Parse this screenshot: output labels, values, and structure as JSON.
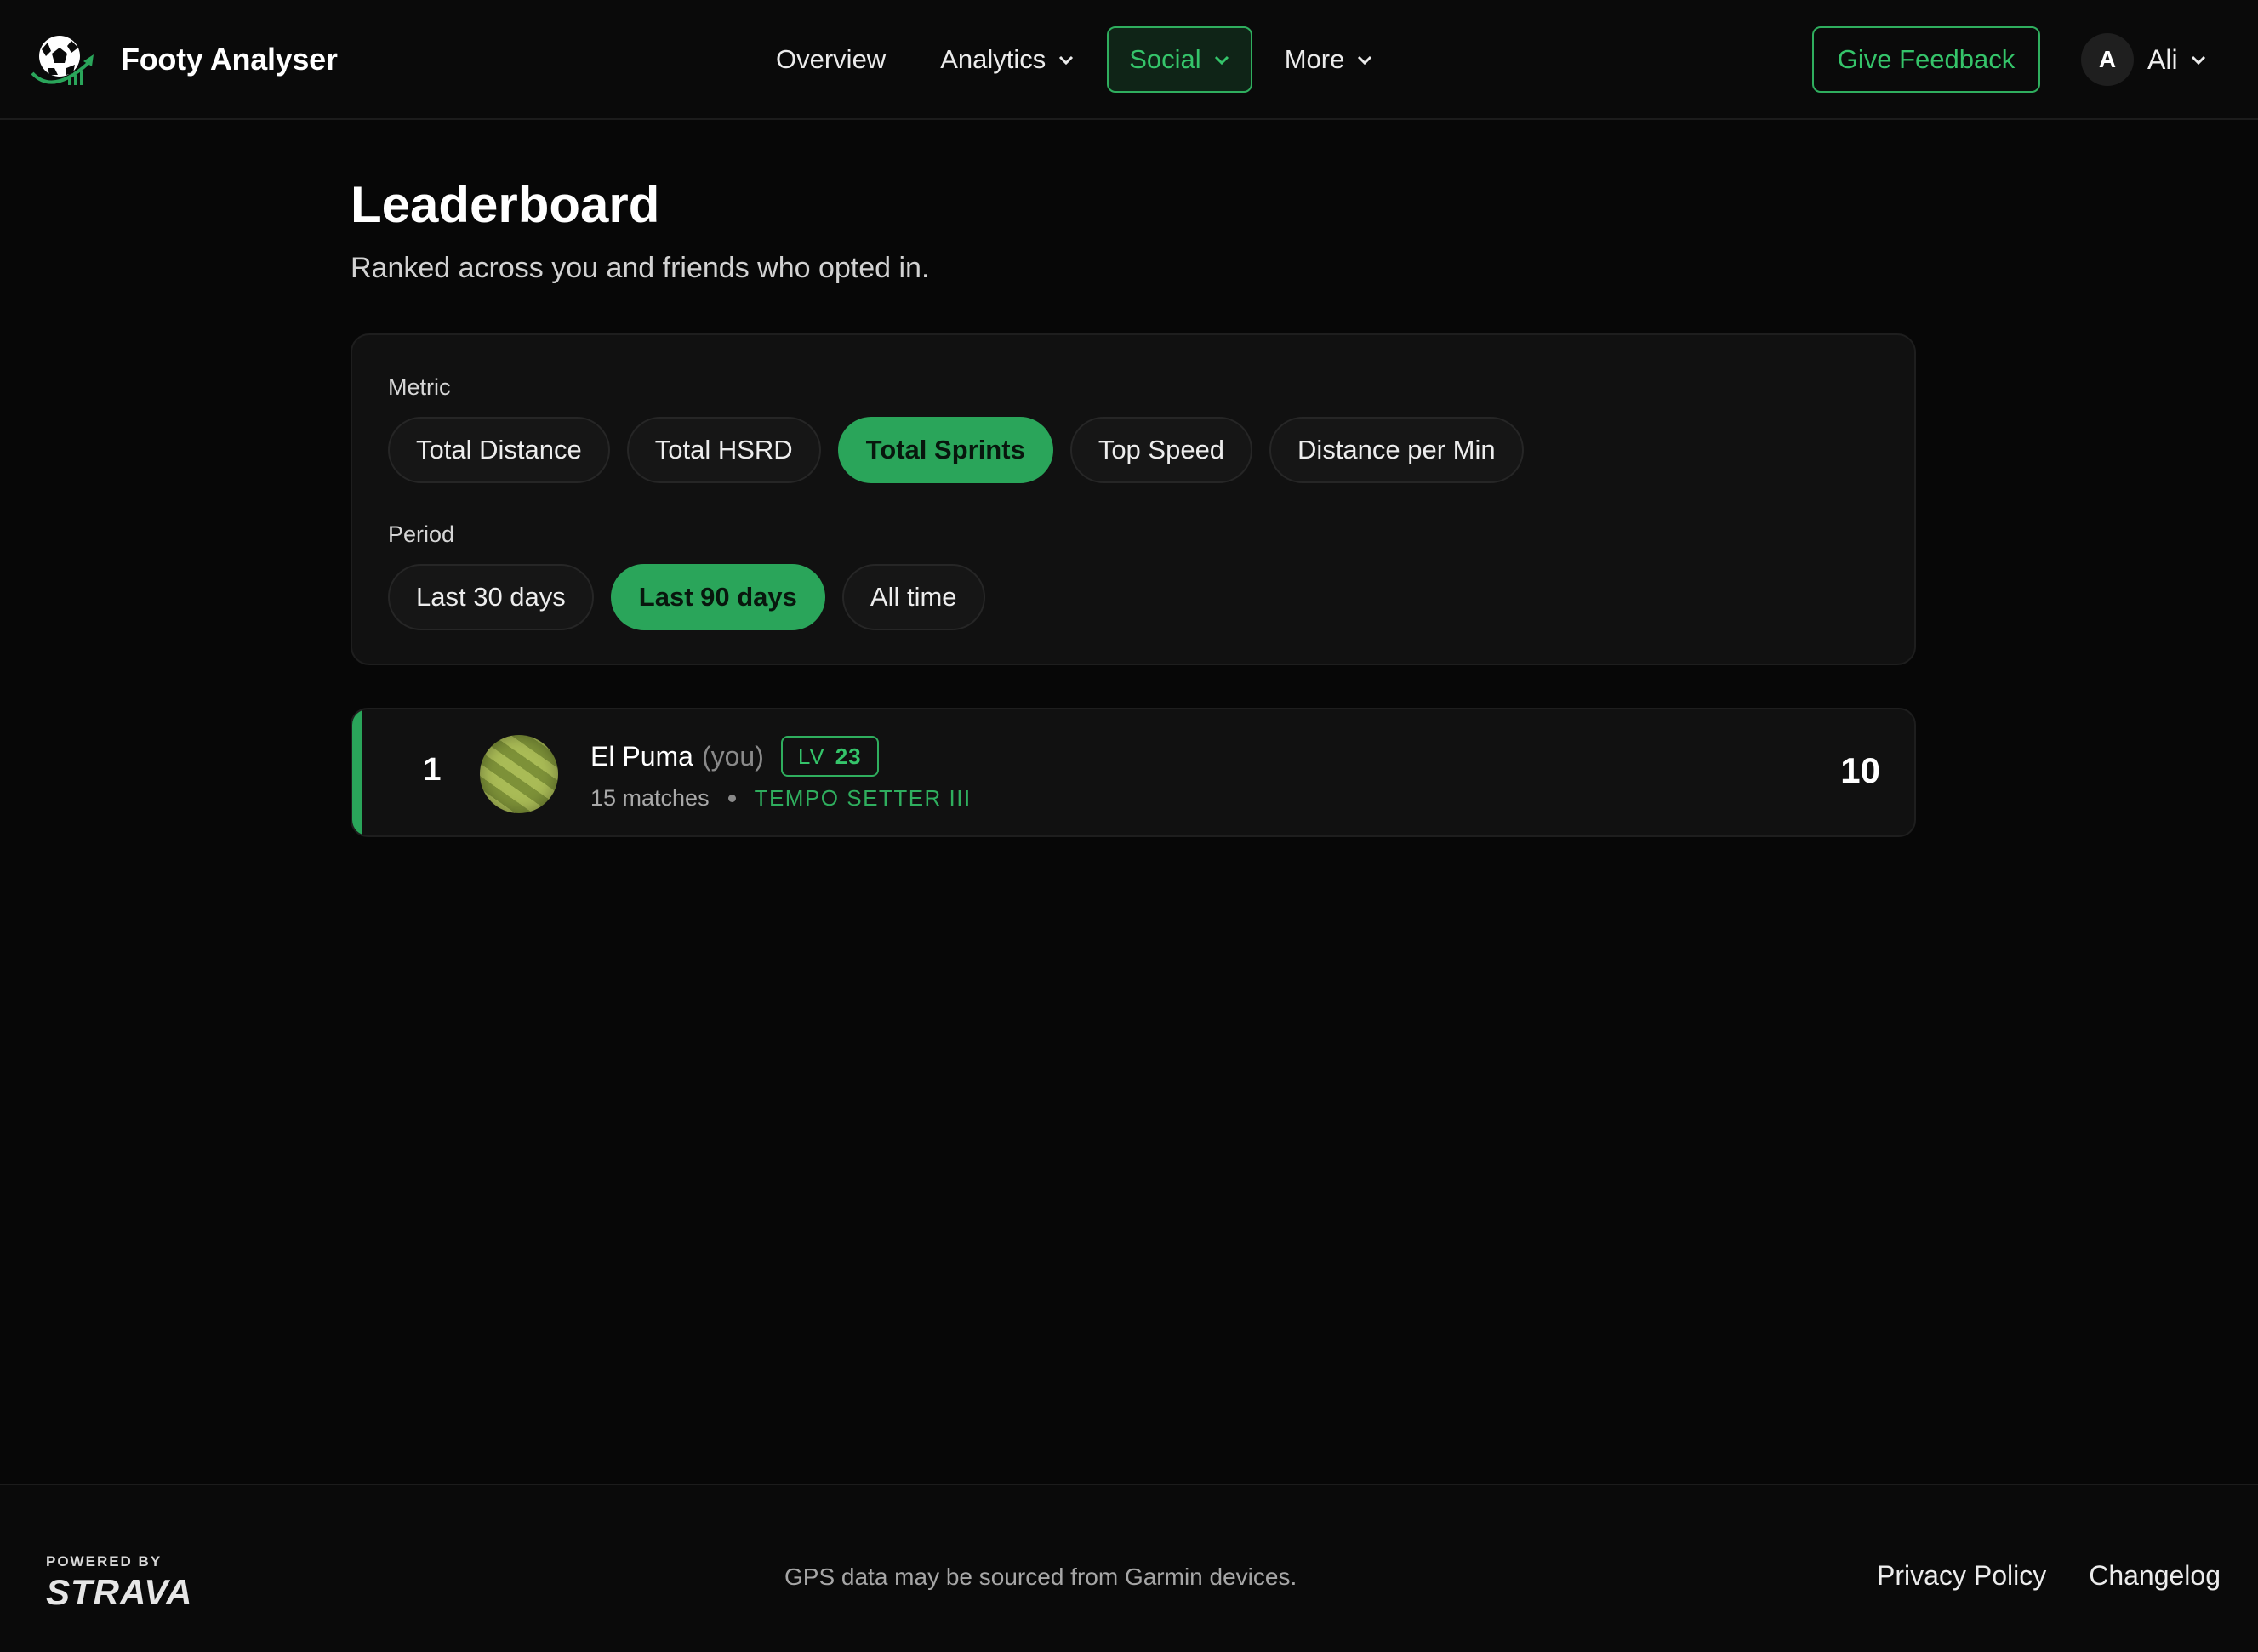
{
  "brand": {
    "name": "Footy Analyser",
    "icon": "football-logo-icon"
  },
  "nav": {
    "items": [
      {
        "label": "Overview",
        "has_dropdown": false,
        "active": false
      },
      {
        "label": "Analytics",
        "has_dropdown": true,
        "active": false
      },
      {
        "label": "Social",
        "has_dropdown": true,
        "active": true
      },
      {
        "label": "More",
        "has_dropdown": true,
        "active": false
      }
    ],
    "feedback_label": "Give Feedback",
    "user": {
      "initial": "A",
      "name": "Ali"
    }
  },
  "page": {
    "title": "Leaderboard",
    "subtitle": "Ranked across you and friends who opted in."
  },
  "filters": {
    "metric_label": "Metric",
    "metrics": [
      "Total Distance",
      "Total HSRD",
      "Total Sprints",
      "Top Speed",
      "Distance per Min"
    ],
    "selected_metric": "Total Sprints",
    "period_label": "Period",
    "periods": [
      "Last 30 days",
      "Last 90 days",
      "All time"
    ],
    "selected_period": "Last 90 days"
  },
  "leaderboard": {
    "rows": [
      {
        "rank": "1",
        "name": "El Puma",
        "you_tag": "(you)",
        "level_prefix": "LV",
        "level": "23",
        "matches": "15 matches",
        "title": "TEMPO SETTER III",
        "value": "10"
      }
    ]
  },
  "footer": {
    "powered_by": "POWERED BY",
    "powered_brand": "STRAVA",
    "note": "GPS data may be sourced from Garmin devices.",
    "links": [
      "Privacy Policy",
      "Changelog"
    ]
  },
  "colors": {
    "accent": "#2aa55a",
    "accent_text": "#35c46a",
    "background": "#070707",
    "card": "#111111"
  }
}
